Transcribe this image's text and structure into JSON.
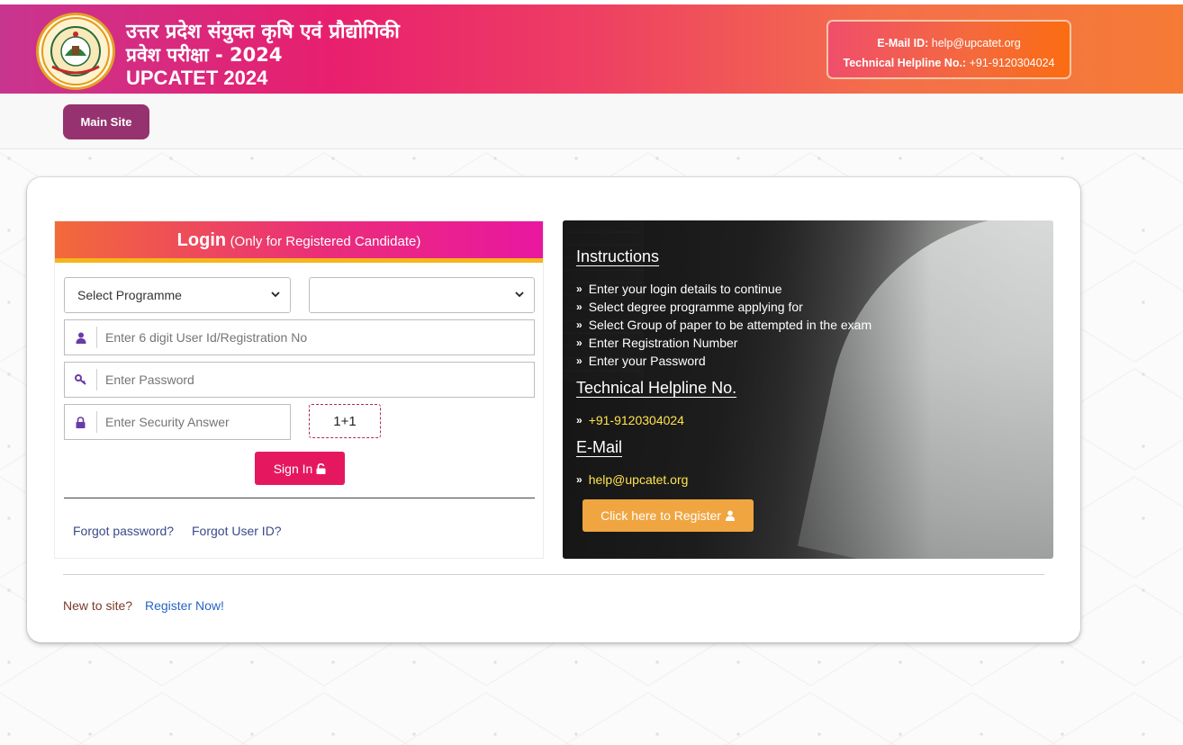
{
  "header": {
    "title_hindi_line1": "उत्तर प्रदेश संयुक्त कृषि एवं प्रौद्योगिकी",
    "title_hindi_line2": "प्रवेश परीक्षा - 2024",
    "title_english": "UPCATET 2024",
    "email_label": "E-Mail ID:",
    "email_value": "help@upcatet.org",
    "helpline_label": "Technical Helpline No.:",
    "helpline_value": "+91-9120304024"
  },
  "nav": {
    "main_site_label": "Main Site"
  },
  "login": {
    "title": "Login",
    "subtitle": "(Only for Registered Candidate)",
    "programme_select": "Select Programme",
    "group_select": "",
    "user_id_placeholder": "Enter 6 digit User Id/Registration No",
    "password_placeholder": "Enter Password",
    "security_placeholder": "Enter Security Answer",
    "captcha_question": "1+1",
    "signin_label": "Sign In",
    "forgot_password": "Forgot password?",
    "forgot_userid": "Forgot User ID?"
  },
  "instructions": {
    "heading": "Instructions",
    "items": [
      "Enter your login details to continue",
      "Select degree programme applying for",
      "Select Group of paper to be attempted in the exam",
      "Enter Registration Number",
      "Enter your Password"
    ],
    "helpline_heading": "Technical Helpline No.",
    "helpline_value": "+91-9120304024",
    "email_heading": "E-Mail",
    "email_value": "help@upcatet.org",
    "register_label": "Click here to Register"
  },
  "footer": {
    "new_to_site": "New to site?",
    "register_now": "Register Now!"
  },
  "colors": {
    "header_start": "#c8358f",
    "header_end": "#f57b35",
    "main_site_button": "#96326f",
    "signin_button": "#e5185f",
    "register_button": "#f0a540",
    "highlight_yellow": "#ffe34d",
    "link_blue": "#2764c4"
  },
  "icons": {
    "user": "user-icon",
    "password": "key-icon",
    "security": "lock-icon",
    "signin": "unlock-icon",
    "register": "user-icon",
    "bullet": "double-chevron-right-icon",
    "select": "chevron-down-icon"
  }
}
